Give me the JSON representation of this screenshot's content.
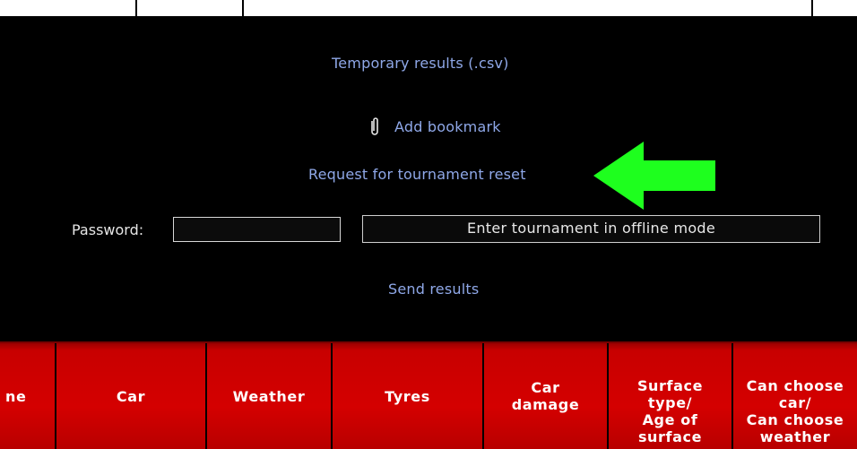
{
  "links": {
    "temporary_results": "Temporary results (.csv)",
    "add_bookmark": "Add bookmark",
    "tournament_reset": "Request for tournament reset",
    "send_results": "Send results"
  },
  "form": {
    "password_label": "Password:",
    "password_value": "",
    "offline_button": "Enter tournament in offline mode"
  },
  "table_header": {
    "columns": [
      "ne",
      "Car",
      "Weather",
      "Tyres",
      "Car\ndamage",
      "Surface\ntype/\nAge of\nsurface",
      "Can choose\ncar/\nCan choose\nweather"
    ]
  },
  "colors": {
    "link": "#8fa8e8",
    "arrow": "#1eff1e",
    "header_red": "#c80000"
  }
}
